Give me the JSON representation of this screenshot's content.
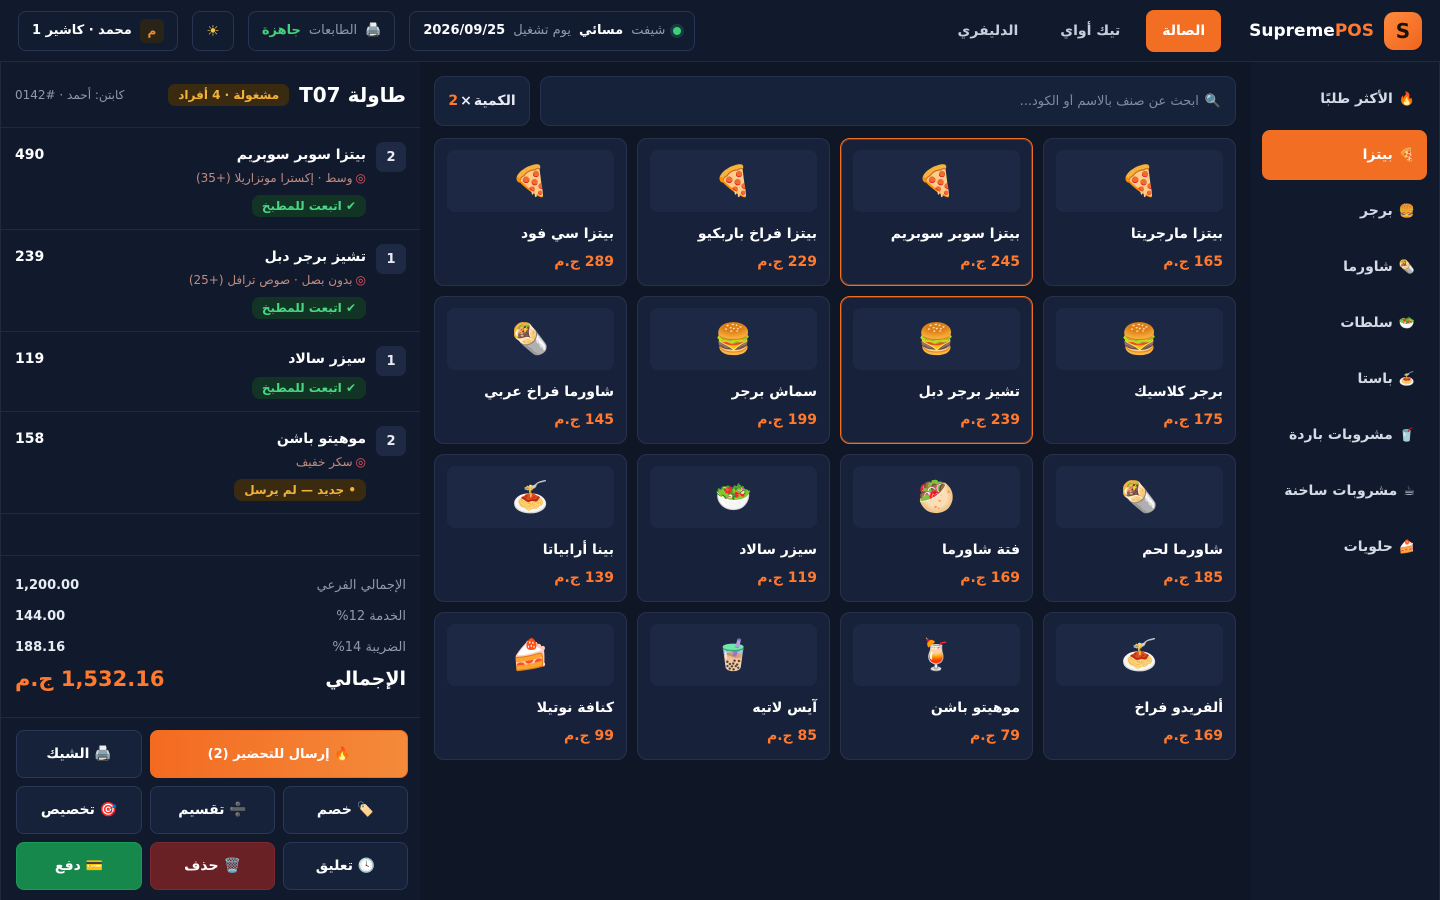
{
  "header": {
    "brand": {
      "logo_letter": "S",
      "name_main": "Supreme",
      "name_accent": "POS"
    },
    "service_tabs": [
      {
        "label": "الصالة",
        "active": true
      },
      {
        "label": "تيك أواي",
        "active": false
      },
      {
        "label": "الدليفري",
        "active": false
      }
    ],
    "shift": {
      "label": "شيفت",
      "value": "مسائي",
      "day_label": "يوم تشغيل",
      "date": "2026/09/25"
    },
    "printer": {
      "label": "الطابعات",
      "status": "جاهزة"
    },
    "theme_icon": "sun-icon",
    "user": {
      "name": "محمد · كاشير 1",
      "avatar": "م"
    }
  },
  "categories": [
    {
      "label": "الأكثر طلبًا",
      "icon": "🔥",
      "active": false
    },
    {
      "label": "بيتزا",
      "icon": "🍕",
      "active": true
    },
    {
      "label": "برجر",
      "icon": "🍔",
      "active": false
    },
    {
      "label": "شاورما",
      "icon": "🌯",
      "active": false
    },
    {
      "label": "سلطات",
      "icon": "🥗",
      "active": false
    },
    {
      "label": "باستا",
      "icon": "🍝",
      "active": false
    },
    {
      "label": "مشروبات باردة",
      "icon": "🥤",
      "active": false
    },
    {
      "label": "مشروبات ساخنة",
      "icon": "☕",
      "active": false
    },
    {
      "label": "حلويات",
      "icon": "🍰",
      "active": false
    }
  ],
  "search": {
    "placeholder": "ابحث عن صنف بالاسم أو الكود...",
    "icon": "🔍"
  },
  "quantity": {
    "label": "الكمية",
    "prefix": "×",
    "value": "2"
  },
  "products": [
    {
      "name": "بيتزا مارجريتا",
      "price": "165 ج.م",
      "emoji": "🍕",
      "selected": false
    },
    {
      "name": "بيتزا سوبر سوبريم",
      "price": "245 ج.م",
      "emoji": "🍕",
      "selected": true
    },
    {
      "name": "بيتزا فراخ باربكيو",
      "price": "229 ج.م",
      "emoji": "🍕",
      "selected": false
    },
    {
      "name": "بيتزا سي فود",
      "price": "289 ج.م",
      "emoji": "🍕",
      "selected": false
    },
    {
      "name": "برجر كلاسيك",
      "price": "175 ج.م",
      "emoji": "🍔",
      "selected": false
    },
    {
      "name": "تشيز برجر دبل",
      "price": "239 ج.م",
      "emoji": "🍔",
      "selected": true
    },
    {
      "name": "سماش برجر",
      "price": "199 ج.م",
      "emoji": "🍔",
      "selected": false
    },
    {
      "name": "شاورما فراخ عربي",
      "price": "145 ج.م",
      "emoji": "🌯",
      "selected": false
    },
    {
      "name": "شاورما لحم",
      "price": "185 ج.م",
      "emoji": "🌯",
      "selected": false
    },
    {
      "name": "فتة شاورما",
      "price": "169 ج.م",
      "emoji": "🥙",
      "selected": false
    },
    {
      "name": "سيزر سالاد",
      "price": "119 ج.م",
      "emoji": "🥗",
      "selected": false
    },
    {
      "name": "بينا أرابياتا",
      "price": "139 ج.م",
      "emoji": "🍝",
      "selected": false
    },
    {
      "name": "ألفريدو فراخ",
      "price": "169 ج.م",
      "emoji": "🍝",
      "selected": false
    },
    {
      "name": "موهيتو باشن",
      "price": "79 ج.م",
      "emoji": "🍹",
      "selected": false
    },
    {
      "name": "آيس لاتيه",
      "price": "85 ج.م",
      "emoji": "🧋",
      "selected": false
    },
    {
      "name": "كنافة نوتيلا",
      "price": "99 ج.م",
      "emoji": "🍰",
      "selected": false
    }
  ],
  "order": {
    "table": "طاولة T07",
    "status": "مشغولة · 4 أفراد",
    "cashier": "كابتن: أحمد · #0142",
    "items": [
      {
        "qty": "2",
        "name": "بيتزا سوبر سوبريم",
        "mods": "وسط · إكسترا موتزاريلا (+35)",
        "chip": "✔ اتبعت للمطبخ",
        "chip_type": "sent",
        "total": "490"
      },
      {
        "qty": "1",
        "name": "تشيز برجر دبل",
        "mods": "بدون بصل · صوص ترافل (+25)",
        "chip": "✔ اتبعت للمطبخ",
        "chip_type": "sent",
        "total": "239"
      },
      {
        "qty": "1",
        "name": "سيزر سالاد",
        "mods": "",
        "chip": "✔ اتبعت للمطبخ",
        "chip_type": "sent",
        "total": "119"
      },
      {
        "qty": "2",
        "name": "موهيتو باشن",
        "mods": "سكر خفيف",
        "chip": "• جديد — لم يرسل",
        "chip_type": "new",
        "total": "158"
      }
    ],
    "subtotal": {
      "label": "الإجمالي الفرعي",
      "value": "1,200.00"
    },
    "service": {
      "label": "الخدمة 12%",
      "value": "144.00"
    },
    "tax": {
      "label": "الضريبة 14%",
      "value": "188.16"
    },
    "grand_total": {
      "label": "الإجمالي",
      "value": "1,532.16 ج.م"
    }
  },
  "actions": {
    "send": "🔥 إرسال للتحضير (2)",
    "check": "🖨️ الشيك",
    "discount": "🏷️ خصم",
    "split": "➗ تقسيم",
    "allocate": "🎯 تخصيص",
    "hold": "🕓 تعليق",
    "delete": "🗑️ حذف",
    "pay": "💳 دفع"
  },
  "colors": {
    "accent": "#f26e23",
    "success": "#17884b",
    "danger": "#6a2126",
    "background": "#0f1626"
  }
}
